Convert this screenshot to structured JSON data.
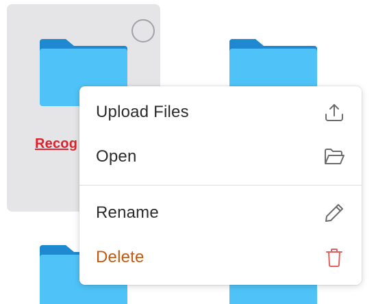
{
  "grid": {
    "folders": [
      {
        "name": "Recog",
        "selected": true
      },
      {
        "name": "",
        "selected": false
      },
      {
        "name": "",
        "selected": false
      },
      {
        "name": "",
        "selected": false
      }
    ]
  },
  "context_menu": {
    "items": [
      {
        "label": "Upload Files",
        "icon": "upload-icon"
      },
      {
        "label": "Open",
        "icon": "folder-open-icon"
      },
      {
        "label": "Rename",
        "icon": "pencil-icon"
      },
      {
        "label": "Delete",
        "icon": "trash-icon"
      }
    ]
  },
  "colors": {
    "folder_front": "#4fc3f7",
    "folder_back": "#1e88d0",
    "selected_tile_bg": "#e5e5e7",
    "folder_name": "#e0202a",
    "delete_label": "#c25a10",
    "delete_icon": "#e06060"
  }
}
